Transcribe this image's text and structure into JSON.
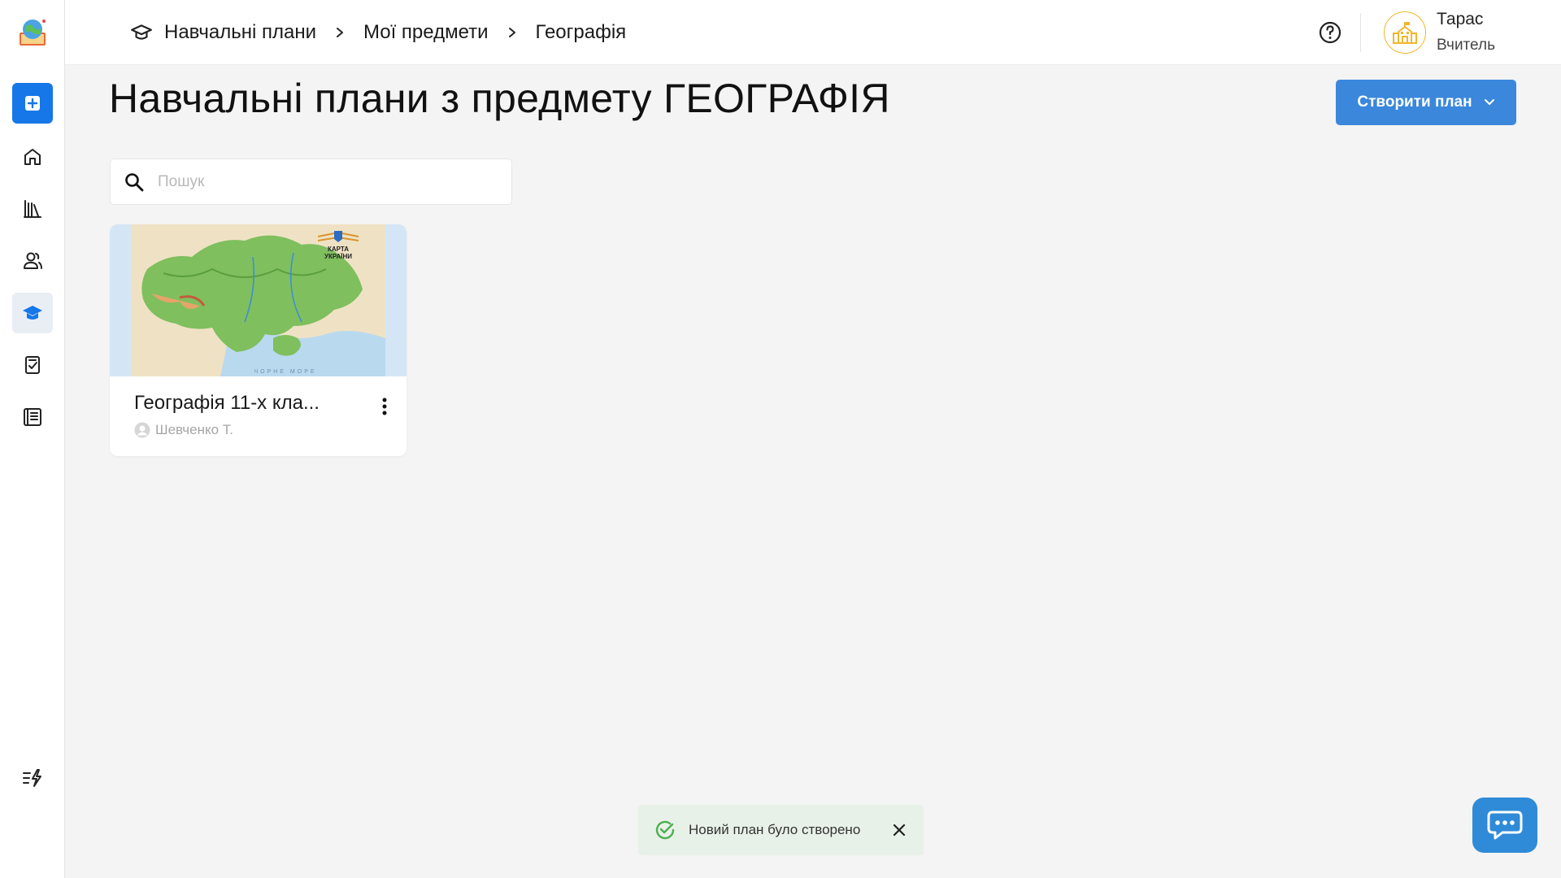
{
  "header": {
    "breadcrumb": [
      {
        "label": "Навчальні плани"
      },
      {
        "label": "Мої предмети"
      },
      {
        "label": "Географія"
      }
    ],
    "user": {
      "name": "Тарас",
      "role": "Вчитель"
    }
  },
  "sidebar": {
    "items": [
      {
        "name": "add",
        "icon": "plus-square-icon"
      },
      {
        "name": "home",
        "icon": "home-icon"
      },
      {
        "name": "library",
        "icon": "books-icon"
      },
      {
        "name": "users",
        "icon": "users-icon"
      },
      {
        "name": "curricula",
        "icon": "graduation-cap-icon",
        "active": true
      },
      {
        "name": "assignments",
        "icon": "checklist-icon"
      },
      {
        "name": "journal",
        "icon": "journal-icon"
      }
    ],
    "bottom": {
      "icon": "flash-list-icon"
    }
  },
  "main": {
    "title": "Навчальні плани з предмету ГЕОГРАФІЯ",
    "create_button": "Створити план",
    "search": {
      "placeholder": "Пошук",
      "value": ""
    },
    "cards": [
      {
        "title": "Географія 11-х кла...",
        "author": "Шевченко Т.",
        "image_caption_line1": "КАРТА",
        "image_caption_line2": "УКРАЇНИ",
        "sea_label": "ЧОРНЕ МОРЕ"
      }
    ]
  },
  "toast": {
    "message": "Новий план було створено"
  },
  "colors": {
    "primary": "#1577e8",
    "button": "#3a87dc",
    "avatar_accent": "#f2b62c",
    "success": "#4caf50",
    "toast_bg": "#e8f1e8"
  }
}
